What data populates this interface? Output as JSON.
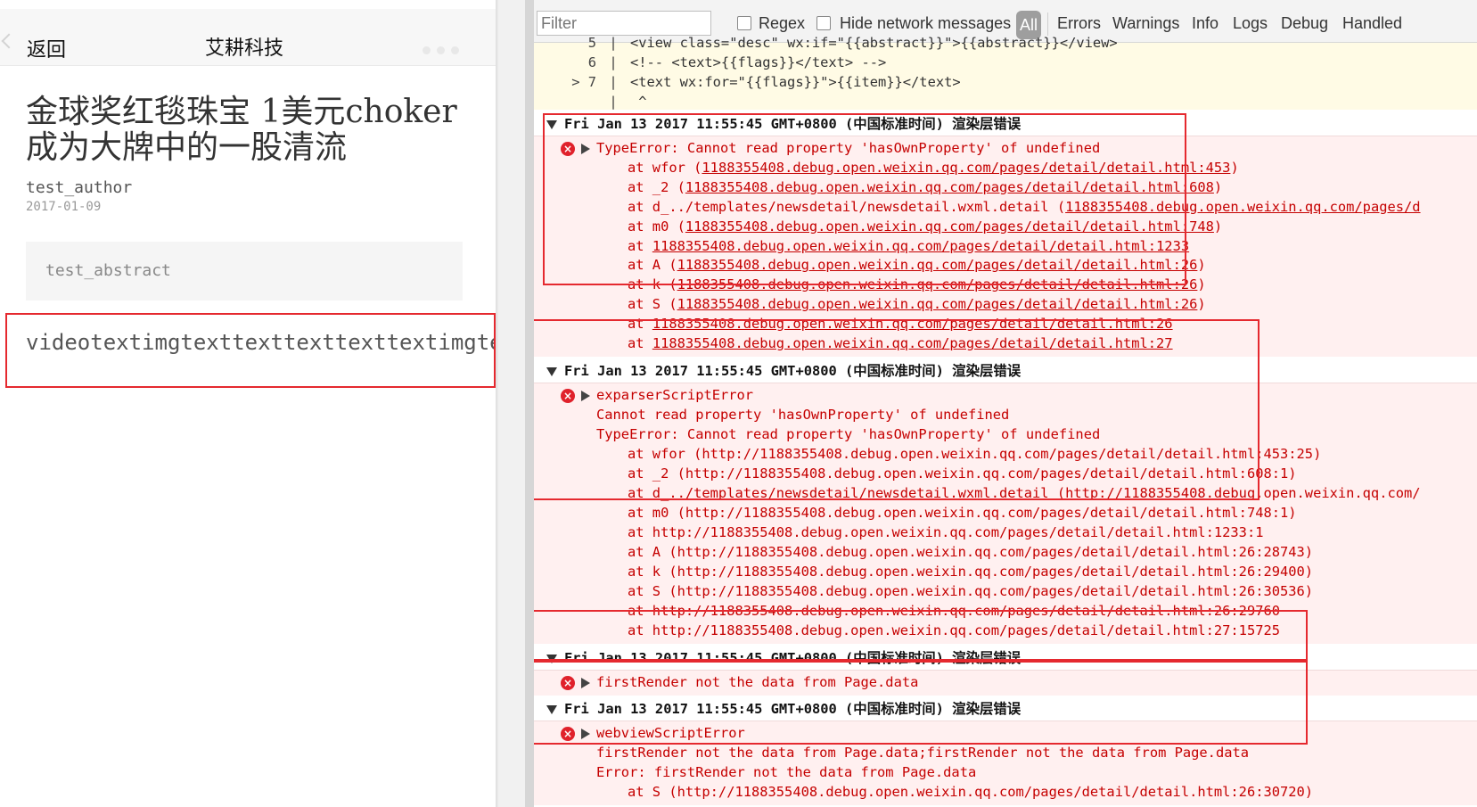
{
  "simulator": {
    "nav": {
      "back_label": "返回",
      "title": "艾耕科技",
      "more_icon": "more-dots-icon"
    },
    "article": {
      "title": "金球奖红毯珠宝 1美元choker 成为大牌中的一股清流",
      "author": "test_author",
      "date": "2017-01-09",
      "abstract": "test_abstract",
      "flags_text": "videotextimgtexttexttexttexttextimgtext"
    }
  },
  "console": {
    "toolbar": {
      "filter_placeholder": "Filter",
      "regex_label": "Regex",
      "hide_network_label": "Hide network messages",
      "all_label": "All",
      "levels": [
        "Errors",
        "Warnings",
        "Info",
        "Logs",
        "Debug",
        "Handled"
      ]
    },
    "code_frame": [
      {
        "marker": "",
        "num": "5",
        "bar": "|",
        "text": "<view class=\"desc\" wx:if=\"{{abstract}}\">{{abstract}}</view>"
      },
      {
        "marker": "",
        "num": "6",
        "bar": "|",
        "text": "<!-- <text>{{flags}}</text> -->"
      },
      {
        "marker": ">",
        "num": "7",
        "bar": "|",
        "text": "<text wx:for=\"{{flags}}\">{{item}}</text>"
      },
      {
        "marker": "",
        "num": "",
        "bar": "|",
        "text": " ^"
      }
    ],
    "groups": [
      {
        "header": "Fri Jan 13 2017 11:55:45 GMT+0800 (中国标准时间) 渲染层错误",
        "lines": [
          {
            "kind": "msg",
            "text": "TypeError: Cannot read property 'hasOwnProperty' of undefined"
          },
          {
            "kind": "stk",
            "text": "at wfor (",
            "link": "1188355408.debug.open.weixin.qq.com/pages/detail/detail.html:453",
            "tail": ")"
          },
          {
            "kind": "stk",
            "text": "at _2 (",
            "link": "1188355408.debug.open.weixin.qq.com/pages/detail/detail.html:608",
            "tail": ")"
          },
          {
            "kind": "stk",
            "text": "at d_../templates/newsdetail/newsdetail.wxml.detail (",
            "link": "1188355408.debug.open.weixin.qq.com/pages/d",
            "tail": ""
          },
          {
            "kind": "stk",
            "text": "at m0 (",
            "link": "1188355408.debug.open.weixin.qq.com/pages/detail/detail.html:748",
            "tail": ")"
          },
          {
            "kind": "stk",
            "text": "at ",
            "link": "1188355408.debug.open.weixin.qq.com/pages/detail/detail.html:1233",
            "tail": ""
          },
          {
            "kind": "stk",
            "text": "at A (",
            "link": "1188355408.debug.open.weixin.qq.com/pages/detail/detail.html:26",
            "tail": ")"
          },
          {
            "kind": "stk",
            "text": "at k (",
            "link": "1188355408.debug.open.weixin.qq.com/pages/detail/detail.html:26",
            "tail": ")"
          },
          {
            "kind": "stk",
            "text": "at S (",
            "link": "1188355408.debug.open.weixin.qq.com/pages/detail/detail.html:26",
            "tail": ")"
          },
          {
            "kind": "stk",
            "text": "at ",
            "link": "1188355408.debug.open.weixin.qq.com/pages/detail/detail.html:26",
            "tail": ""
          },
          {
            "kind": "stk",
            "text": "at ",
            "link": "1188355408.debug.open.weixin.qq.com/pages/detail/detail.html:27",
            "tail": ""
          }
        ]
      },
      {
        "header": "Fri Jan 13 2017 11:55:45 GMT+0800 (中国标准时间) 渲染层错误",
        "lines": [
          {
            "kind": "msg",
            "text": "exparserScriptError"
          },
          {
            "kind": "msg2",
            "text": "Cannot read property 'hasOwnProperty' of undefined"
          },
          {
            "kind": "msg2",
            "text": "TypeError: Cannot read property 'hasOwnProperty' of undefined"
          },
          {
            "kind": "stk",
            "text": "at wfor (http://1188355408.debug.open.weixin.qq.com/pages/detail/detail.html:453:25)"
          },
          {
            "kind": "stk",
            "text": "at _2 (http://1188355408.debug.open.weixin.qq.com/pages/detail/detail.html:608:1)"
          },
          {
            "kind": "stk",
            "text": "at d_../templates/newsdetail/newsdetail.wxml.detail (http://1188355408.debug.open.weixin.qq.com/"
          },
          {
            "kind": "stk",
            "text": "at m0 (http://1188355408.debug.open.weixin.qq.com/pages/detail/detail.html:748:1)"
          },
          {
            "kind": "stk",
            "text": "at http://1188355408.debug.open.weixin.qq.com/pages/detail/detail.html:1233:1"
          },
          {
            "kind": "stk",
            "text": "at A (http://1188355408.debug.open.weixin.qq.com/pages/detail/detail.html:26:28743)"
          },
          {
            "kind": "stk",
            "text": "at k (http://1188355408.debug.open.weixin.qq.com/pages/detail/detail.html:26:29400)"
          },
          {
            "kind": "stk",
            "text": "at S (http://1188355408.debug.open.weixin.qq.com/pages/detail/detail.html:26:30536)"
          },
          {
            "kind": "stk",
            "text": "at http://1188355408.debug.open.weixin.qq.com/pages/detail/detail.html:26:29760"
          },
          {
            "kind": "stk",
            "text": "at http://1188355408.debug.open.weixin.qq.com/pages/detail/detail.html:27:15725"
          }
        ]
      },
      {
        "header": "Fri Jan 13 2017 11:55:45 GMT+0800 (中国标准时间) 渲染层错误",
        "lines": [
          {
            "kind": "msg",
            "text": "firstRender not the data from Page.data"
          }
        ]
      },
      {
        "header": "Fri Jan 13 2017 11:55:45 GMT+0800 (中国标准时间) 渲染层错误",
        "lines": [
          {
            "kind": "msg",
            "text": "webviewScriptError"
          },
          {
            "kind": "msg2",
            "text": "firstRender not the data from Page.data;firstRender not the data from Page.data"
          },
          {
            "kind": "msg2",
            "text": "Error: firstRender not the data from Page.data"
          },
          {
            "kind": "stk",
            "text": "at S (http://1188355408.debug.open.weixin.qq.com/pages/detail/detail.html:26:30720)"
          }
        ]
      }
    ]
  },
  "colors": {
    "error_text": "#c50000",
    "error_bg": "#fff0f0",
    "highlight": "#e5292f",
    "code_bg": "#fffbe5"
  }
}
